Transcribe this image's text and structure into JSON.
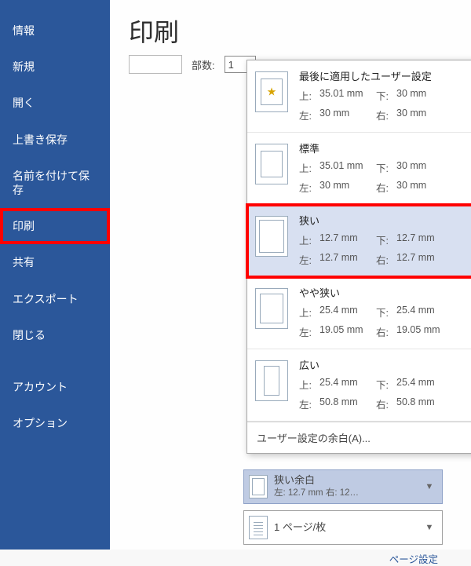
{
  "sidebar": {
    "items": [
      {
        "label": "情報"
      },
      {
        "label": "新規"
      },
      {
        "label": "開く"
      },
      {
        "label": "上書き保存"
      },
      {
        "label": "名前を付けて保存"
      },
      {
        "label": "印刷"
      },
      {
        "label": "共有"
      },
      {
        "label": "エクスポート"
      },
      {
        "label": "閉じる"
      },
      {
        "label": "アカウント"
      },
      {
        "label": "オプション"
      }
    ]
  },
  "main": {
    "title": "印刷",
    "copies_label": "部数:",
    "copies_value": "1"
  },
  "labels": {
    "top": "上:",
    "bottom": "下:",
    "left": "左:",
    "right": "右:"
  },
  "popup": {
    "options": [
      {
        "title": "最後に適用したユーザー設定",
        "top": "35.01 mm",
        "bottom": "30 mm",
        "left": "30 mm",
        "right": "30 mm"
      },
      {
        "title": "標準",
        "top": "35.01 mm",
        "bottom": "30 mm",
        "left": "30 mm",
        "right": "30 mm"
      },
      {
        "title": "狭い",
        "top": "12.7 mm",
        "bottom": "12.7 mm",
        "left": "12.7 mm",
        "right": "12.7 mm"
      },
      {
        "title": "やや狭い",
        "top": "25.4 mm",
        "bottom": "25.4 mm",
        "left": "19.05 mm",
        "right": "19.05 mm"
      },
      {
        "title": "広い",
        "top": "25.4 mm",
        "bottom": "25.4 mm",
        "left": "50.8 mm",
        "right": "50.8 mm"
      }
    ],
    "footer": "ユーザー設定の余白(A)..."
  },
  "fields": {
    "margin": {
      "title": "狭い余白",
      "sub": "左: 12.7 mm   右: 12…"
    },
    "pages": {
      "title": "1 ページ/枚"
    }
  },
  "page_setup": "ページ設定"
}
